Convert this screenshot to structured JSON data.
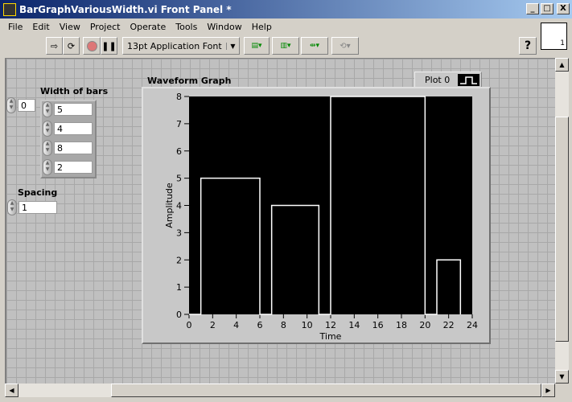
{
  "window": {
    "title": "BarGraphVariousWidth.vi Front Panel *",
    "min": "_",
    "max": "□",
    "close": "X"
  },
  "menu": [
    "File",
    "Edit",
    "View",
    "Project",
    "Operate",
    "Tools",
    "Window",
    "Help"
  ],
  "toolbar": {
    "font": "13pt Application Font",
    "help": "?",
    "vi_icon_number": "1"
  },
  "controls": {
    "index_value": "0",
    "width_label": "Width of bars",
    "widths": [
      "5",
      "4",
      "8",
      "2"
    ],
    "spacing_label": "Spacing",
    "spacing_value": "1"
  },
  "chart_data": {
    "type": "line",
    "title": "Waveform Graph",
    "xlabel": "Time",
    "ylabel": "Amplitude",
    "xlim": [
      0,
      24
    ],
    "ylim": [
      0,
      8
    ],
    "xticks": [
      "0",
      "2",
      "4",
      "6",
      "8",
      "10",
      "12",
      "14",
      "16",
      "18",
      "20",
      "22",
      "24"
    ],
    "yticks": [
      "0",
      "1",
      "2",
      "3",
      "4",
      "5",
      "6",
      "7",
      "8"
    ],
    "legend": {
      "label": "Plot 0",
      "placement": "top-right"
    },
    "series": [
      {
        "name": "Plot 0",
        "x": [
          0,
          1,
          1,
          6,
          6,
          7,
          7,
          11,
          11,
          12,
          12,
          20,
          20,
          21,
          21,
          23,
          23
        ],
        "y": [
          0,
          0,
          5,
          5,
          0,
          0,
          4,
          4,
          0,
          0,
          8,
          8,
          0,
          0,
          2,
          2,
          0
        ]
      }
    ],
    "colors": {
      "plot": "#ffffff",
      "background": "#000000"
    }
  }
}
